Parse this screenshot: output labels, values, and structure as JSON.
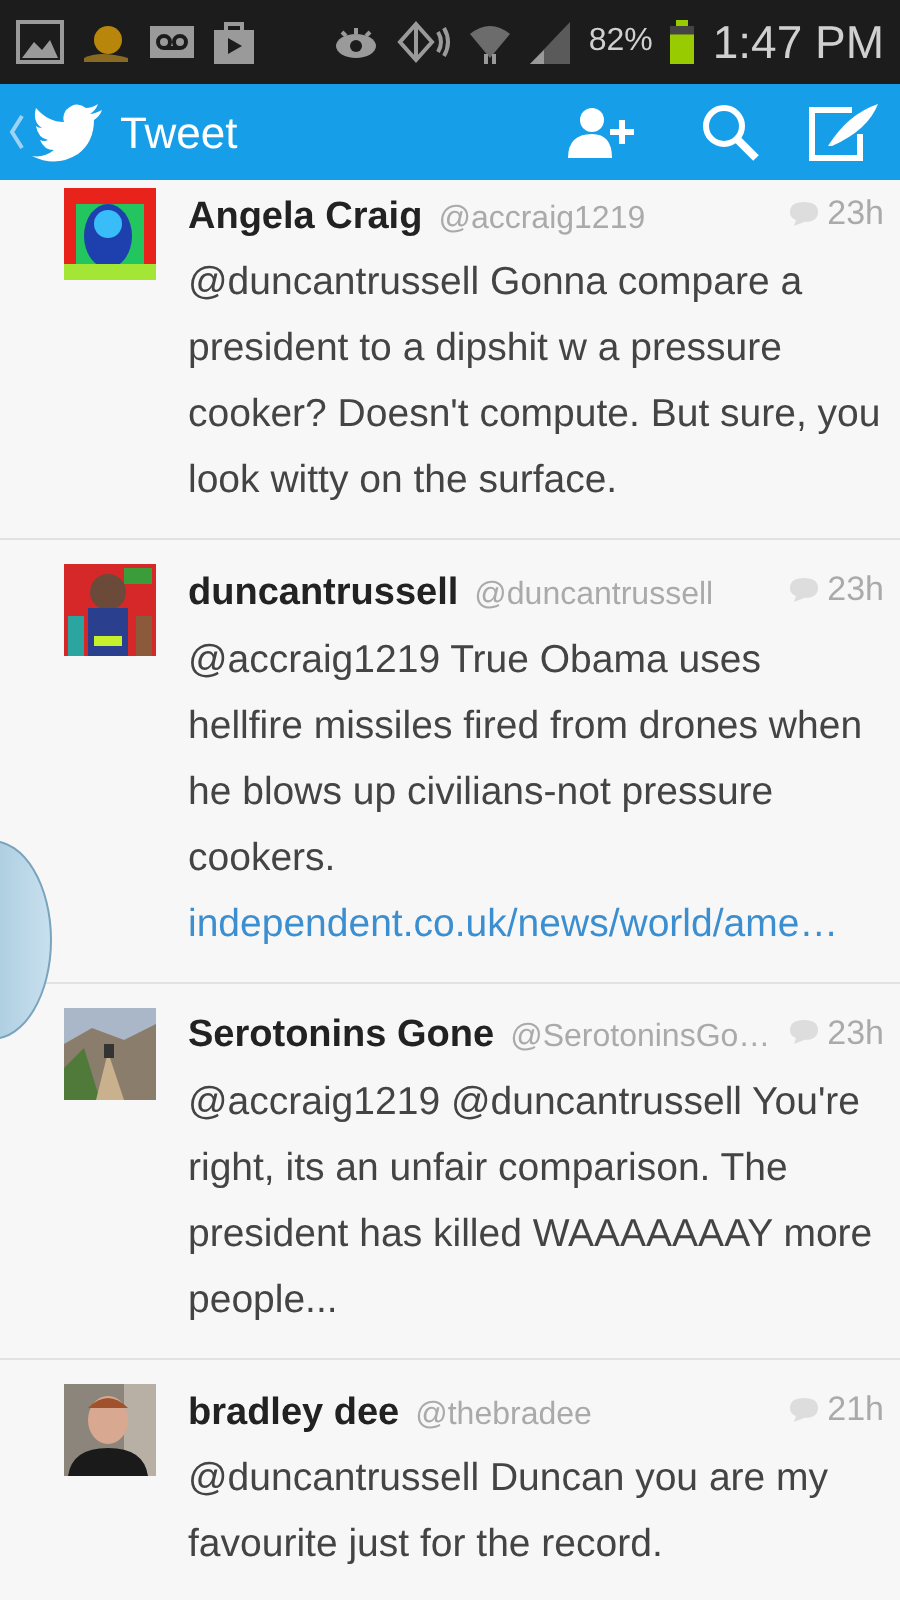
{
  "status_bar": {
    "battery_text": "82%",
    "battery": {
      "level": 0.82
    },
    "time": "1:47 PM"
  },
  "header": {
    "title": "Tweet"
  },
  "tweets": [
    {
      "name": "Angela Craig",
      "handle": "@accraig1219",
      "time": "23h",
      "body": "@duncantrussell Gonna compare a president to a dipshit w a pressure cooker? Doesn't compute. But sure, you look witty on the surface."
    },
    {
      "name": "duncantrussell",
      "handle": "@duncantrussell",
      "time": "23h",
      "body": "@accraig1219 True Obama uses hellfire missiles fired from drones when he blows up civilians-not pressure cookers.",
      "link": "independent.co.uk/news/world/ame…"
    },
    {
      "name": "Serotonins Gone",
      "handle": "@SerotoninsGo…",
      "time": "23h",
      "body": "@accraig1219 @duncantrussell You're right, its an unfair comparison. The president has killed WAAAAAAAY more people..."
    },
    {
      "name": "bradley dee",
      "handle": "@thebradee",
      "time": "21h",
      "body": "@duncantrussell Duncan you are my favourite just for the record."
    }
  ]
}
